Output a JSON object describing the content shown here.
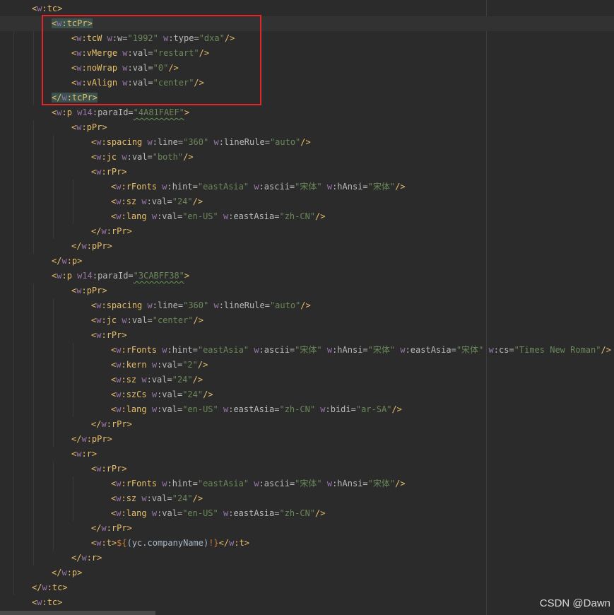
{
  "editor": {
    "lines": [
      [
        [
          "b",
          "<"
        ],
        [
          "n",
          "w"
        ],
        [
          "b",
          ":tc>"
        ]
      ],
      [
        [
          "b",
          "<"
        ],
        [
          "n",
          "w"
        ],
        [
          "b",
          ":tcPr>"
        ]
      ],
      [
        [
          "b",
          "<"
        ],
        [
          "n",
          "w"
        ],
        [
          "b",
          ":tcW "
        ],
        [
          "n",
          "w"
        ],
        [
          "a",
          ":w="
        ],
        [
          "v",
          "\"1992\" "
        ],
        [
          "n",
          "w"
        ],
        [
          "a",
          ":type="
        ],
        [
          "v",
          "\"dxa\""
        ],
        [
          "b",
          "/>"
        ]
      ],
      [
        [
          "b",
          "<"
        ],
        [
          "n",
          "w"
        ],
        [
          "b",
          ":vMerge "
        ],
        [
          "n",
          "w"
        ],
        [
          "a",
          ":val="
        ],
        [
          "v",
          "\"restart\""
        ],
        [
          "b",
          "/>"
        ]
      ],
      [
        [
          "b",
          "<"
        ],
        [
          "n",
          "w"
        ],
        [
          "b",
          ":noWrap "
        ],
        [
          "n",
          "w"
        ],
        [
          "a",
          ":val="
        ],
        [
          "v",
          "\"0\""
        ],
        [
          "b",
          "/>"
        ]
      ],
      [
        [
          "b",
          "<"
        ],
        [
          "n",
          "w"
        ],
        [
          "b",
          ":vAlign "
        ],
        [
          "n",
          "w"
        ],
        [
          "a",
          ":val="
        ],
        [
          "v",
          "\"center\""
        ],
        [
          "b",
          "/>"
        ]
      ],
      [
        [
          "b",
          "</"
        ],
        [
          "n",
          "w"
        ],
        [
          "b",
          ":tcPr>"
        ]
      ],
      [
        [
          "b",
          "<"
        ],
        [
          "n",
          "w"
        ],
        [
          "b",
          ":p "
        ],
        [
          "n",
          "w14"
        ],
        [
          "a",
          ":paraId="
        ],
        [
          "v",
          "\"4A81FAEF\""
        ],
        [
          "b",
          ">"
        ]
      ],
      [
        [
          "b",
          "<"
        ],
        [
          "n",
          "w"
        ],
        [
          "b",
          ":pPr>"
        ]
      ],
      [
        [
          "b",
          "<"
        ],
        [
          "n",
          "w"
        ],
        [
          "b",
          ":spacing "
        ],
        [
          "n",
          "w"
        ],
        [
          "a",
          ":line="
        ],
        [
          "v",
          "\"360\" "
        ],
        [
          "n",
          "w"
        ],
        [
          "a",
          ":lineRule="
        ],
        [
          "v",
          "\"auto\""
        ],
        [
          "b",
          "/>"
        ]
      ],
      [
        [
          "b",
          "<"
        ],
        [
          "n",
          "w"
        ],
        [
          "b",
          ":jc "
        ],
        [
          "n",
          "w"
        ],
        [
          "a",
          ":val="
        ],
        [
          "v",
          "\"both\""
        ],
        [
          "b",
          "/>"
        ]
      ],
      [
        [
          "b",
          "<"
        ],
        [
          "n",
          "w"
        ],
        [
          "b",
          ":rPr>"
        ]
      ],
      [
        [
          "b",
          "<"
        ],
        [
          "n",
          "w"
        ],
        [
          "b",
          ":rFonts "
        ],
        [
          "n",
          "w"
        ],
        [
          "a",
          ":hint="
        ],
        [
          "v",
          "\"eastAsia\" "
        ],
        [
          "n",
          "w"
        ],
        [
          "a",
          ":ascii="
        ],
        [
          "v",
          "\"宋体\" "
        ],
        [
          "n",
          "w"
        ],
        [
          "a",
          ":hAnsi="
        ],
        [
          "v",
          "\"宋体\""
        ],
        [
          "b",
          "/>"
        ]
      ],
      [
        [
          "b",
          "<"
        ],
        [
          "n",
          "w"
        ],
        [
          "b",
          ":sz "
        ],
        [
          "n",
          "w"
        ],
        [
          "a",
          ":val="
        ],
        [
          "v",
          "\"24\""
        ],
        [
          "b",
          "/>"
        ]
      ],
      [
        [
          "b",
          "<"
        ],
        [
          "n",
          "w"
        ],
        [
          "b",
          ":lang "
        ],
        [
          "n",
          "w"
        ],
        [
          "a",
          ":val="
        ],
        [
          "v",
          "\"en-US\" "
        ],
        [
          "n",
          "w"
        ],
        [
          "a",
          ":eastAsia="
        ],
        [
          "v",
          "\"zh-CN\""
        ],
        [
          "b",
          "/>"
        ]
      ],
      [
        [
          "b",
          "</"
        ],
        [
          "n",
          "w"
        ],
        [
          "b",
          ":rPr>"
        ]
      ],
      [
        [
          "b",
          "</"
        ],
        [
          "n",
          "w"
        ],
        [
          "b",
          ":pPr>"
        ]
      ],
      [
        [
          "b",
          "</"
        ],
        [
          "n",
          "w"
        ],
        [
          "b",
          ":p>"
        ]
      ],
      [
        [
          "b",
          "<"
        ],
        [
          "n",
          "w"
        ],
        [
          "b",
          ":p "
        ],
        [
          "n",
          "w14"
        ],
        [
          "a",
          ":paraId="
        ],
        [
          "v",
          "\"3CABFF38\""
        ],
        [
          "b",
          ">"
        ]
      ],
      [
        [
          "b",
          "<"
        ],
        [
          "n",
          "w"
        ],
        [
          "b",
          ":pPr>"
        ]
      ],
      [
        [
          "b",
          "<"
        ],
        [
          "n",
          "w"
        ],
        [
          "b",
          ":spacing "
        ],
        [
          "n",
          "w"
        ],
        [
          "a",
          ":line="
        ],
        [
          "v",
          "\"360\" "
        ],
        [
          "n",
          "w"
        ],
        [
          "a",
          ":lineRule="
        ],
        [
          "v",
          "\"auto\""
        ],
        [
          "b",
          "/>"
        ]
      ],
      [
        [
          "b",
          "<"
        ],
        [
          "n",
          "w"
        ],
        [
          "b",
          ":jc "
        ],
        [
          "n",
          "w"
        ],
        [
          "a",
          ":val="
        ],
        [
          "v",
          "\"center\""
        ],
        [
          "b",
          "/>"
        ]
      ],
      [
        [
          "b",
          "<"
        ],
        [
          "n",
          "w"
        ],
        [
          "b",
          ":rPr>"
        ]
      ],
      [
        [
          "b",
          "<"
        ],
        [
          "n",
          "w"
        ],
        [
          "b",
          ":rFonts "
        ],
        [
          "n",
          "w"
        ],
        [
          "a",
          ":hint="
        ],
        [
          "v",
          "\"eastAsia\" "
        ],
        [
          "n",
          "w"
        ],
        [
          "a",
          ":ascii="
        ],
        [
          "v",
          "\"宋体\" "
        ],
        [
          "n",
          "w"
        ],
        [
          "a",
          ":hAnsi="
        ],
        [
          "v",
          "\"宋体\" "
        ],
        [
          "n",
          "w"
        ],
        [
          "a",
          ":eastAsia="
        ],
        [
          "v",
          "\"宋体\" "
        ],
        [
          "n",
          "w"
        ],
        [
          "a",
          ":cs="
        ],
        [
          "v",
          "\"Times New Roman\""
        ],
        [
          "b",
          "/>"
        ]
      ],
      [
        [
          "b",
          "<"
        ],
        [
          "n",
          "w"
        ],
        [
          "b",
          ":kern "
        ],
        [
          "n",
          "w"
        ],
        [
          "a",
          ":val="
        ],
        [
          "v",
          "\"2\""
        ],
        [
          "b",
          "/>"
        ]
      ],
      [
        [
          "b",
          "<"
        ],
        [
          "n",
          "w"
        ],
        [
          "b",
          ":sz "
        ],
        [
          "n",
          "w"
        ],
        [
          "a",
          ":val="
        ],
        [
          "v",
          "\"24\""
        ],
        [
          "b",
          "/>"
        ]
      ],
      [
        [
          "b",
          "<"
        ],
        [
          "n",
          "w"
        ],
        [
          "b",
          ":szCs "
        ],
        [
          "n",
          "w"
        ],
        [
          "a",
          ":val="
        ],
        [
          "v",
          "\"24\""
        ],
        [
          "b",
          "/>"
        ]
      ],
      [
        [
          "b",
          "<"
        ],
        [
          "n",
          "w"
        ],
        [
          "b",
          ":lang "
        ],
        [
          "n",
          "w"
        ],
        [
          "a",
          ":val="
        ],
        [
          "v",
          "\"en-US\" "
        ],
        [
          "n",
          "w"
        ],
        [
          "a",
          ":eastAsia="
        ],
        [
          "v",
          "\"zh-CN\" "
        ],
        [
          "n",
          "w"
        ],
        [
          "a",
          ":bidi="
        ],
        [
          "v",
          "\"ar-SA\""
        ],
        [
          "b",
          "/>"
        ]
      ],
      [
        [
          "b",
          "</"
        ],
        [
          "n",
          "w"
        ],
        [
          "b",
          ":rPr>"
        ]
      ],
      [
        [
          "b",
          "</"
        ],
        [
          "n",
          "w"
        ],
        [
          "b",
          ":pPr>"
        ]
      ],
      [
        [
          "b",
          "<"
        ],
        [
          "n",
          "w"
        ],
        [
          "b",
          ":r>"
        ]
      ],
      [
        [
          "b",
          "<"
        ],
        [
          "n",
          "w"
        ],
        [
          "b",
          ":rPr>"
        ]
      ],
      [
        [
          "b",
          "<"
        ],
        [
          "n",
          "w"
        ],
        [
          "b",
          ":rFonts "
        ],
        [
          "n",
          "w"
        ],
        [
          "a",
          ":hint="
        ],
        [
          "v",
          "\"eastAsia\" "
        ],
        [
          "n",
          "w"
        ],
        [
          "a",
          ":ascii="
        ],
        [
          "v",
          "\"宋体\" "
        ],
        [
          "n",
          "w"
        ],
        [
          "a",
          ":hAnsi="
        ],
        [
          "v",
          "\"宋体\""
        ],
        [
          "b",
          "/>"
        ]
      ],
      [
        [
          "b",
          "<"
        ],
        [
          "n",
          "w"
        ],
        [
          "b",
          ":sz "
        ],
        [
          "n",
          "w"
        ],
        [
          "a",
          ":val="
        ],
        [
          "v",
          "\"24\""
        ],
        [
          "b",
          "/>"
        ]
      ],
      [
        [
          "b",
          "<"
        ],
        [
          "n",
          "w"
        ],
        [
          "b",
          ":lang "
        ],
        [
          "n",
          "w"
        ],
        [
          "a",
          ":val="
        ],
        [
          "v",
          "\"en-US\" "
        ],
        [
          "n",
          "w"
        ],
        [
          "a",
          ":eastAsia="
        ],
        [
          "v",
          "\"zh-CN\""
        ],
        [
          "b",
          "/>"
        ]
      ],
      [
        [
          "b",
          "</"
        ],
        [
          "n",
          "w"
        ],
        [
          "b",
          ":rPr>"
        ]
      ],
      [
        [
          "b",
          "<"
        ],
        [
          "n",
          "w"
        ],
        [
          "b",
          ":t>"
        ],
        [
          "brace",
          "${"
        ],
        [
          "t",
          "(yc.companyName)"
        ],
        [
          "brace",
          "!}"
        ],
        [
          "b",
          "</"
        ],
        [
          "n",
          "w"
        ],
        [
          "b",
          ":t>"
        ]
      ],
      [
        [
          "b",
          "</"
        ],
        [
          "n",
          "w"
        ],
        [
          "b",
          ":r>"
        ]
      ],
      [
        [
          "b",
          "</"
        ],
        [
          "n",
          "w"
        ],
        [
          "b",
          ":p>"
        ]
      ],
      [
        [
          "b",
          "</"
        ],
        [
          "n",
          "w"
        ],
        [
          "b",
          ":tc>"
        ]
      ],
      [
        [
          "b",
          "<"
        ],
        [
          "n",
          "w"
        ],
        [
          "b",
          ":tc>"
        ]
      ]
    ]
  },
  "watermark": "CSDN @Dawn"
}
